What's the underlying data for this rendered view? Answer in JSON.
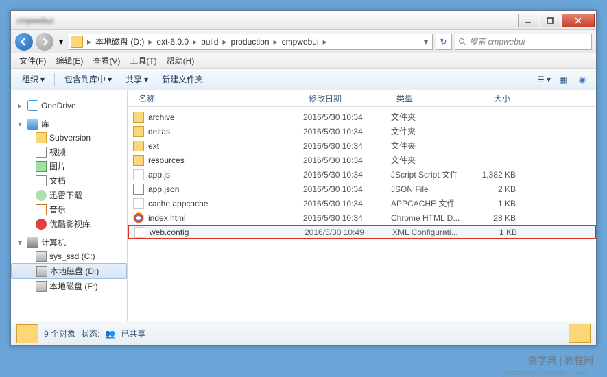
{
  "breadcrumb": [
    "本地磁盘 (D:)",
    "ext-6.0.0",
    "build",
    "production",
    "cmpwebui"
  ],
  "search_placeholder": "搜索 cmpwebui",
  "menubar": [
    "文件(F)",
    "编辑(E)",
    "查看(V)",
    "工具(T)",
    "帮助(H)"
  ],
  "toolbar": {
    "organize": "组织",
    "include": "包含到库中",
    "share": "共享",
    "newfolder": "新建文件夹"
  },
  "columns": {
    "name": "名称",
    "date": "修改日期",
    "type": "类型",
    "size": "大小"
  },
  "sidebar": {
    "onedrive": "OneDrive",
    "libraries": "库",
    "subversion": "Subversion",
    "videos": "视频",
    "pictures": "图片",
    "documents": "文档",
    "downloads": "迅雷下载",
    "music": "音乐",
    "youku": "优酷影视库",
    "computer": "计算机",
    "disk_c": "sys_ssd (C:)",
    "disk_d": "本地磁盘 (D:)",
    "disk_e": "本地磁盘 (E:)"
  },
  "files": [
    {
      "name": "archive",
      "date": "2016/5/30 10:34",
      "type": "文件夹",
      "size": "",
      "icon": "ic-fold-y"
    },
    {
      "name": "deltas",
      "date": "2016/5/30 10:34",
      "type": "文件夹",
      "size": "",
      "icon": "ic-fold-y"
    },
    {
      "name": "ext",
      "date": "2016/5/30 10:34",
      "type": "文件夹",
      "size": "",
      "icon": "ic-fold-y"
    },
    {
      "name": "resources",
      "date": "2016/5/30 10:34",
      "type": "文件夹",
      "size": "",
      "icon": "ic-fold-y"
    },
    {
      "name": "app.js",
      "date": "2016/5/30 10:34",
      "type": "JScript Script 文件",
      "size": "1,382 KB",
      "icon": "ic-js"
    },
    {
      "name": "app.json",
      "date": "2016/5/30 10:34",
      "type": "JSON File",
      "size": "2 KB",
      "icon": "ic-json"
    },
    {
      "name": "cache.appcache",
      "date": "2016/5/30 10:34",
      "type": "APPCACHE 文件",
      "size": "1 KB",
      "icon": "ic-cache"
    },
    {
      "name": "index.html",
      "date": "2016/5/30 10:34",
      "type": "Chrome HTML D...",
      "size": "28 KB",
      "icon": "ic-chrome"
    },
    {
      "name": "web.config",
      "date": "2016/5/30 10:49",
      "type": "XML Configurati...",
      "size": "1 KB",
      "icon": "ic-xml",
      "highlighted": true
    }
  ],
  "status": {
    "count": "9 个对象",
    "state_label": "状态:",
    "state": "已共享"
  },
  "watermark": "查字典 | 教程网",
  "watermark2": "jiaocheng.chazidian.com"
}
